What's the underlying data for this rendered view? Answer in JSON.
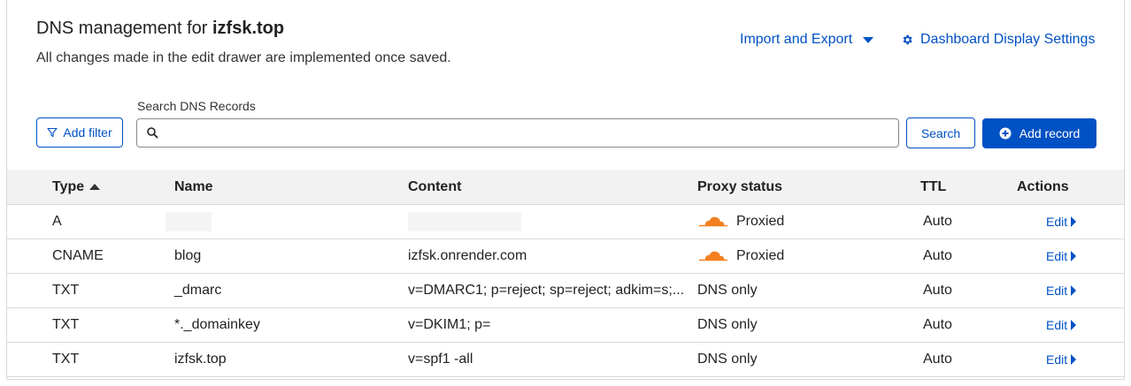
{
  "header": {
    "title_prefix": "DNS management for",
    "domain": "izfsk.top",
    "subtitle": "All changes made in the edit drawer are implemented once saved."
  },
  "links": {
    "import_export": "Import and Export",
    "dashboard_settings": "Dashboard Display Settings"
  },
  "toolbar": {
    "filter_label": "Add filter",
    "search_label": "Search DNS Records",
    "search_value": "",
    "search_button": "Search",
    "add_record": "Add record"
  },
  "table": {
    "columns": [
      "Type",
      "Name",
      "Content",
      "Proxy status",
      "TTL",
      "Actions"
    ],
    "sorted_column": "Type",
    "sort_direction": "ascending",
    "rows": [
      {
        "type": "A",
        "name": "",
        "content": "",
        "proxy": "Proxied",
        "proxied": true,
        "ttl": "Auto",
        "action": "Edit",
        "name_redacted": true,
        "content_redacted": true
      },
      {
        "type": "CNAME",
        "name": "blog",
        "content": "izfsk.onrender.com",
        "proxy": "Proxied",
        "proxied": true,
        "ttl": "Auto",
        "action": "Edit"
      },
      {
        "type": "TXT",
        "name": "_dmarc",
        "content": "v=DMARC1; p=reject; sp=reject; adkim=s;...",
        "proxy": "DNS only",
        "proxied": false,
        "ttl": "Auto",
        "action": "Edit"
      },
      {
        "type": "TXT",
        "name": "*._domainkey",
        "content": "v=DKIM1; p=",
        "proxy": "DNS only",
        "proxied": false,
        "ttl": "Auto",
        "action": "Edit"
      },
      {
        "type": "TXT",
        "name": "izfsk.top",
        "content": "v=spf1 -all",
        "proxy": "DNS only",
        "proxied": false,
        "ttl": "Auto",
        "action": "Edit"
      }
    ]
  },
  "colors": {
    "accent": "#0051c3",
    "cloud": "#f38020",
    "header_bg": "#f2f2f2"
  },
  "icons": {
    "filter": "filter-icon",
    "search": "search-icon",
    "add": "plus-circle-icon",
    "settings": "gear-icon",
    "proxied": "orange-cloud-icon",
    "sort": "sort-up-icon"
  }
}
